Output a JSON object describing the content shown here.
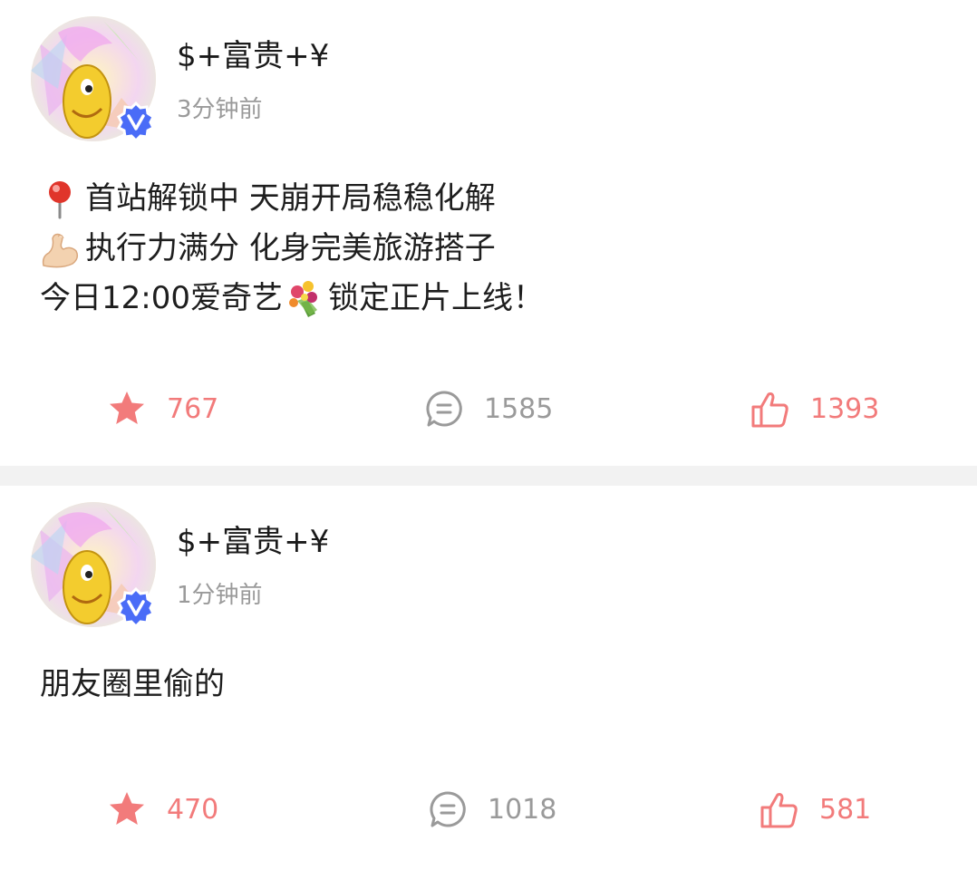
{
  "posts": [
    {
      "username": "$+富贵+¥",
      "time": "3分钟前",
      "lines": [
        {
          "emoji": "round-pushpin",
          "text": "首站解锁中 天崩开局稳稳化解"
        },
        {
          "emoji": "flexed-biceps",
          "text": "执行力满分 化身完美旅游搭子"
        },
        {
          "emoji": null,
          "text_before": "今日12:00爱奇艺",
          "inline_emoji": "bouquet",
          "text_after": "锁定正片上线！"
        }
      ],
      "actions": {
        "favorite": {
          "icon": "star-icon",
          "count": "767"
        },
        "comment": {
          "icon": "comment-icon",
          "count": "1585"
        },
        "like": {
          "icon": "thumbs-up-icon",
          "count": "1393"
        }
      }
    },
    {
      "username": "$+富贵+¥",
      "time": "1分钟前",
      "lines": [
        {
          "emoji": null,
          "text": "朋友圈里偷的"
        }
      ],
      "actions": {
        "favorite": {
          "icon": "star-icon",
          "count": "470"
        },
        "comment": {
          "icon": "comment-icon",
          "count": "1018"
        },
        "like": {
          "icon": "thumbs-up-icon",
          "count": "581"
        }
      }
    }
  ],
  "colors": {
    "accent_red": "#f27b7b",
    "verified_blue": "#4a6cf7",
    "muted_gray": "#9a9a9a",
    "separator": "#f2f2f2"
  }
}
